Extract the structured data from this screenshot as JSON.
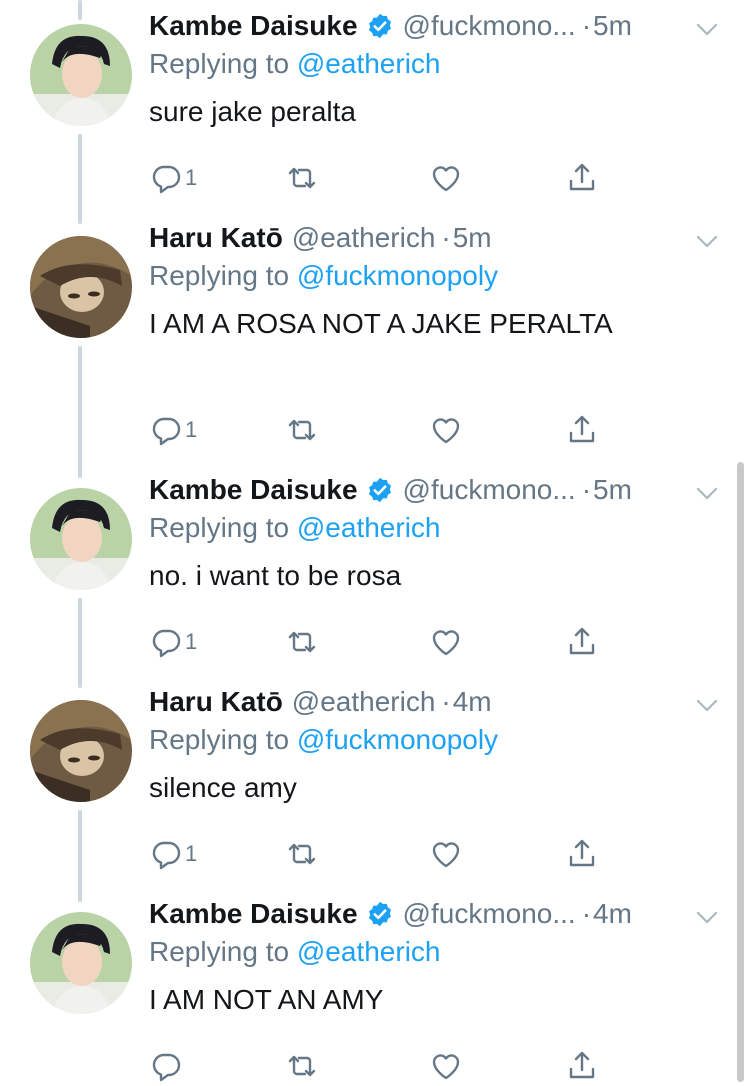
{
  "colors": {
    "link": "#1da1f2",
    "secondary": "#657786",
    "thread_line": "#ccd6dd",
    "text": "#14171a"
  },
  "tweets": [
    {
      "name": "Kambe Daisuke",
      "verified": true,
      "handle": "@fuckmono...",
      "time": "5m",
      "replying_label": "Replying to",
      "replying_to": "@eatherich",
      "text": "sure jake peralta",
      "reply_count": "1"
    },
    {
      "name": "Haru Katō",
      "verified": false,
      "handle": "@eatherich",
      "time": "5m",
      "replying_label": "Replying to",
      "replying_to": "@fuckmonopoly",
      "text": "I AM A ROSA NOT A JAKE PERALTA",
      "reply_count": "1"
    },
    {
      "name": "Kambe Daisuke",
      "verified": true,
      "handle": "@fuckmono...",
      "time": "5m",
      "replying_label": "Replying to",
      "replying_to": "@eatherich",
      "text": "no. i want to be rosa",
      "reply_count": "1"
    },
    {
      "name": "Haru Katō",
      "verified": false,
      "handle": "@eatherich",
      "time": "4m",
      "replying_label": "Replying to",
      "replying_to": "@fuckmonopoly",
      "text": "silence amy",
      "reply_count": "1"
    },
    {
      "name": "Kambe Daisuke",
      "verified": true,
      "handle": "@fuckmono...",
      "time": "4m",
      "replying_label": "Replying to",
      "replying_to": "@eatherich",
      "text": "I AM NOT AN AMY",
      "reply_count": ""
    }
  ],
  "icons": {
    "reply": "reply-icon",
    "retweet": "retweet-icon",
    "like": "heart-icon",
    "share": "share-icon",
    "more": "chevron-down-icon",
    "verified": "verified-badge-icon"
  }
}
